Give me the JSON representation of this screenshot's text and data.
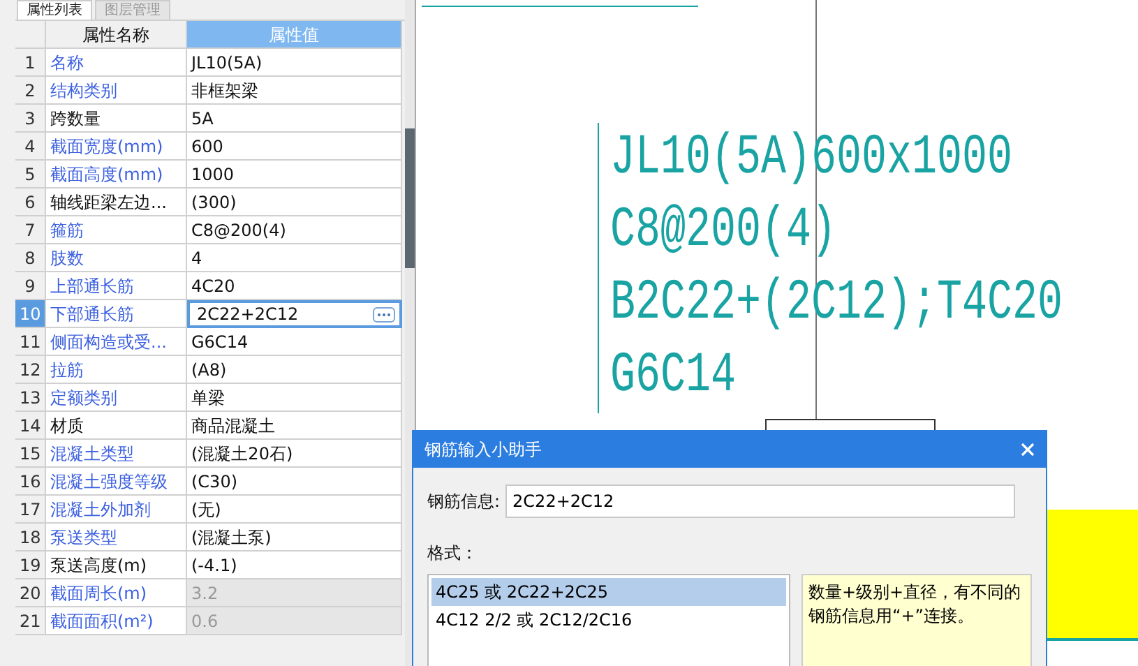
{
  "tabs": [
    {
      "label": "属性列表",
      "selected": true
    },
    {
      "label": "图层管理",
      "selected": false
    }
  ],
  "table": {
    "columns": [
      "属性名称",
      "属性值"
    ],
    "rows": [
      {
        "index": "1",
        "name": "名称",
        "value": "JL10(5A)",
        "public": true,
        "disabled": false,
        "selected": false
      },
      {
        "index": "2",
        "name": "结构类别",
        "value": "非框架梁",
        "public": true,
        "disabled": false,
        "selected": false
      },
      {
        "index": "3",
        "name": "跨数量",
        "value": "5A",
        "public": false,
        "disabled": false,
        "selected": false
      },
      {
        "index": "4",
        "name": "截面宽度(mm)",
        "value": "600",
        "public": true,
        "disabled": false,
        "selected": false
      },
      {
        "index": "5",
        "name": "截面高度(mm)",
        "value": "1000",
        "public": true,
        "disabled": false,
        "selected": false
      },
      {
        "index": "6",
        "name": "轴线距梁左边...",
        "value": "(300)",
        "public": false,
        "disabled": false,
        "selected": false
      },
      {
        "index": "7",
        "name": "箍筋",
        "value": "C8@200(4)",
        "public": true,
        "disabled": false,
        "selected": false
      },
      {
        "index": "8",
        "name": "肢数",
        "value": "4",
        "public": true,
        "disabled": false,
        "selected": false
      },
      {
        "index": "9",
        "name": "上部通长筋",
        "value": "4C20",
        "public": true,
        "disabled": false,
        "selected": false
      },
      {
        "index": "10",
        "name": "下部通长筋",
        "value": "2C22+2C12",
        "public": true,
        "disabled": false,
        "selected": true
      },
      {
        "index": "11",
        "name": "侧面构造或受...",
        "value": "G6C14",
        "public": true,
        "disabled": false,
        "selected": false
      },
      {
        "index": "12",
        "name": "拉筋",
        "value": "(A8)",
        "public": true,
        "disabled": false,
        "selected": false
      },
      {
        "index": "13",
        "name": "定额类别",
        "value": "单梁",
        "public": true,
        "disabled": false,
        "selected": false
      },
      {
        "index": "14",
        "name": "材质",
        "value": "商品混凝土",
        "public": false,
        "disabled": false,
        "selected": false
      },
      {
        "index": "15",
        "name": "混凝土类型",
        "value": "(混凝土20石)",
        "public": true,
        "disabled": false,
        "selected": false
      },
      {
        "index": "16",
        "name": "混凝土强度等级",
        "value": "(C30)",
        "public": true,
        "disabled": false,
        "selected": false
      },
      {
        "index": "17",
        "name": "混凝土外加剂",
        "value": "(无)",
        "public": true,
        "disabled": false,
        "selected": false
      },
      {
        "index": "18",
        "name": "泵送类型",
        "value": "(混凝土泵)",
        "public": true,
        "disabled": false,
        "selected": false
      },
      {
        "index": "19",
        "name": "泵送高度(m)",
        "value": "(-4.1)",
        "public": false,
        "disabled": false,
        "selected": false
      },
      {
        "index": "20",
        "name": "截面周长(m)",
        "value": "3.2",
        "public": true,
        "disabled": true,
        "selected": false
      },
      {
        "index": "21",
        "name": "截面面积(m²)",
        "value": "0.6",
        "public": true,
        "disabled": true,
        "selected": false
      }
    ]
  },
  "canvas": {
    "annotation_lines": [
      "JL10(5A)600x1000",
      "C8@200(4)",
      "B2C22+(2C12);T4C20",
      "G6C14"
    ]
  },
  "dialog": {
    "title": "钢筋输入小助手",
    "field_label": "钢筋信息:",
    "field_value": "2C22+2C12",
    "format_label": "格式：",
    "formats": [
      {
        "text": "4C25 或 2C22+2C25",
        "selected": true
      },
      {
        "text": "4C12 2/2 或 2C12/2C16",
        "selected": false
      }
    ],
    "hint": "数量+级别+直径，有不同的钢筋信息用“+”连接。"
  }
}
